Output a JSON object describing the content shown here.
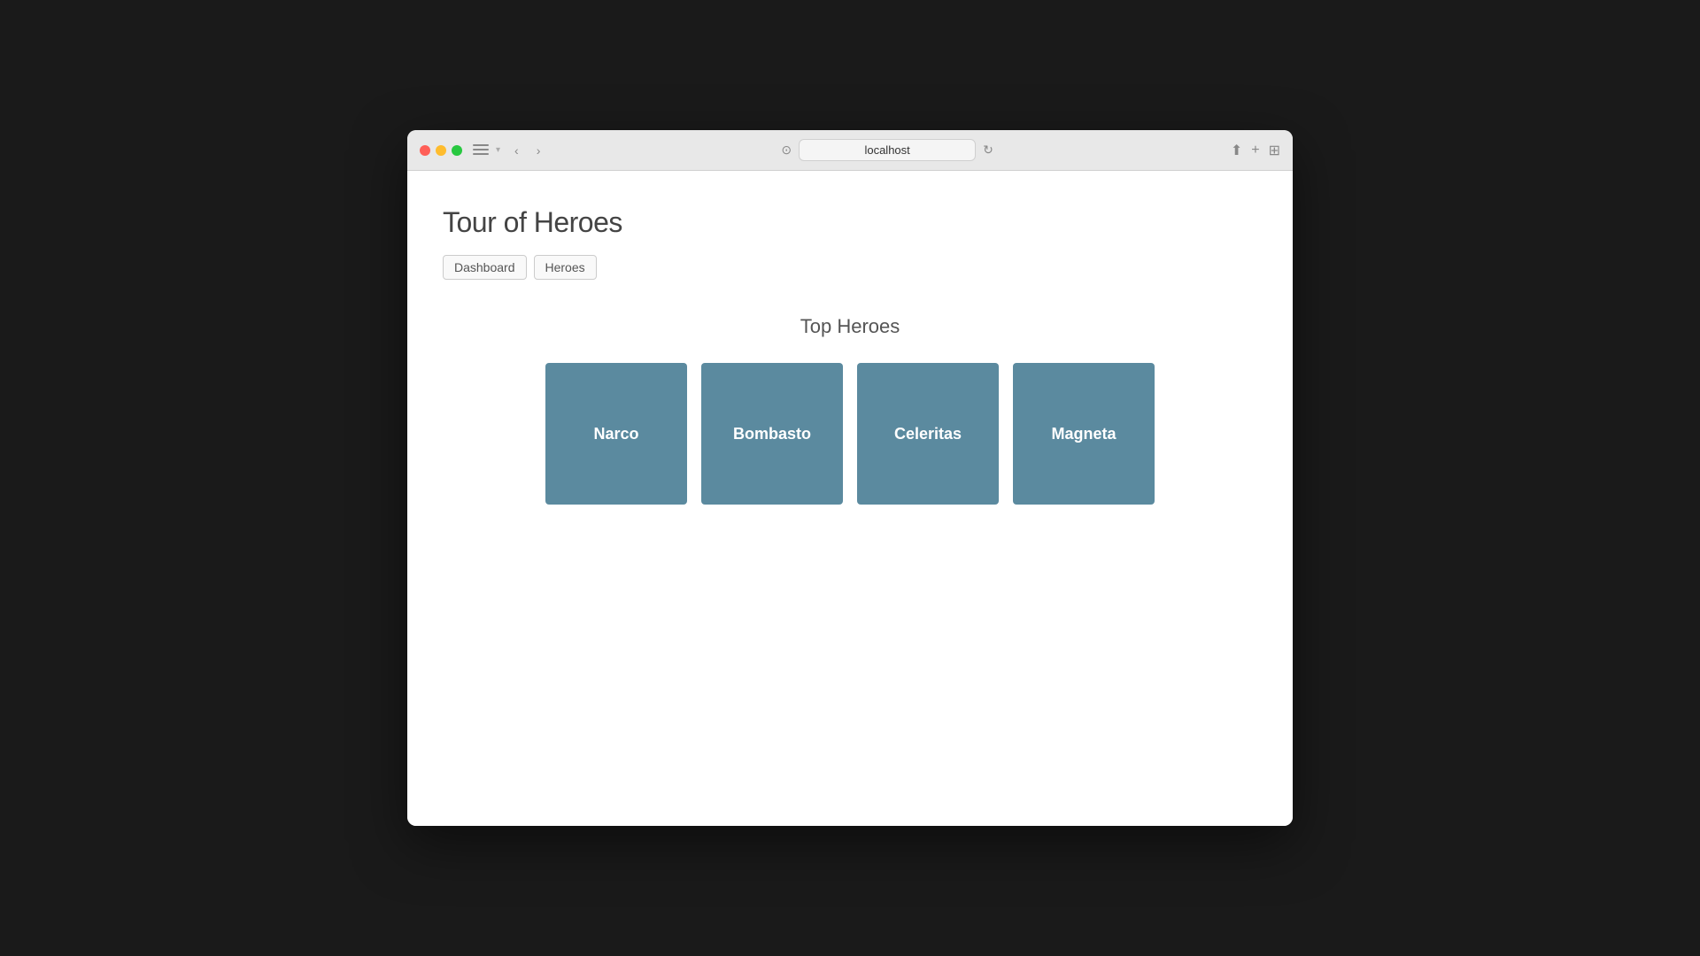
{
  "browser": {
    "url": "localhost",
    "back_btn": "‹",
    "forward_btn": "›",
    "reload_btn": "↻",
    "share_icon": "⬆",
    "new_tab_icon": "+",
    "grid_icon": "⊞"
  },
  "app": {
    "title": "Tour of Heroes",
    "nav": [
      {
        "label": "Dashboard",
        "id": "dashboard"
      },
      {
        "label": "Heroes",
        "id": "heroes"
      }
    ],
    "dashboard": {
      "section_title": "Top Heroes",
      "heroes": [
        {
          "name": "Narco"
        },
        {
          "name": "Bombasto"
        },
        {
          "name": "Celeritas"
        },
        {
          "name": "Magneta"
        }
      ]
    }
  }
}
